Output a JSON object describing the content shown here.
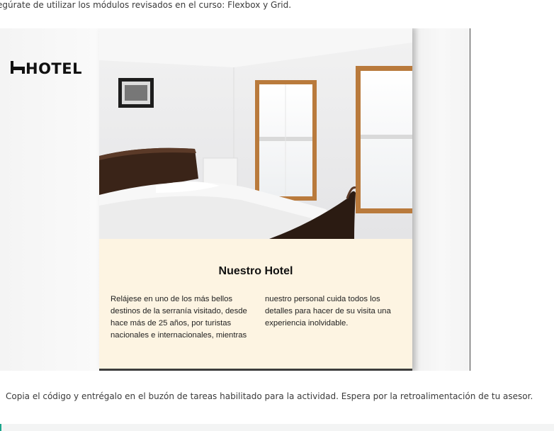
{
  "intro_text": "egúrate de utilizar los módulos revisados en el curso: Flexbox y Grid.",
  "mockup": {
    "logo_text": "HOTEL",
    "logo_icon": "bed-icon",
    "card_title": "Nuestro Hotel",
    "col_1": "Relájese en uno de los más bellos destinos de la serranía visitado, desde hace más de 25 años, por turistas nacionales e internacionales, mientras",
    "col_2": "nuestro personal cuida todos los detalles para hacer de su visita una experiencia inolvidable.",
    "card_bg": "#fdf4e2"
  },
  "outro_text": "Copia el código y entrégalo en el buzón de tareas habilitado para la actividad. Espera por la retroalimentación de tu asesor.",
  "accent_color": "#1aa58c"
}
